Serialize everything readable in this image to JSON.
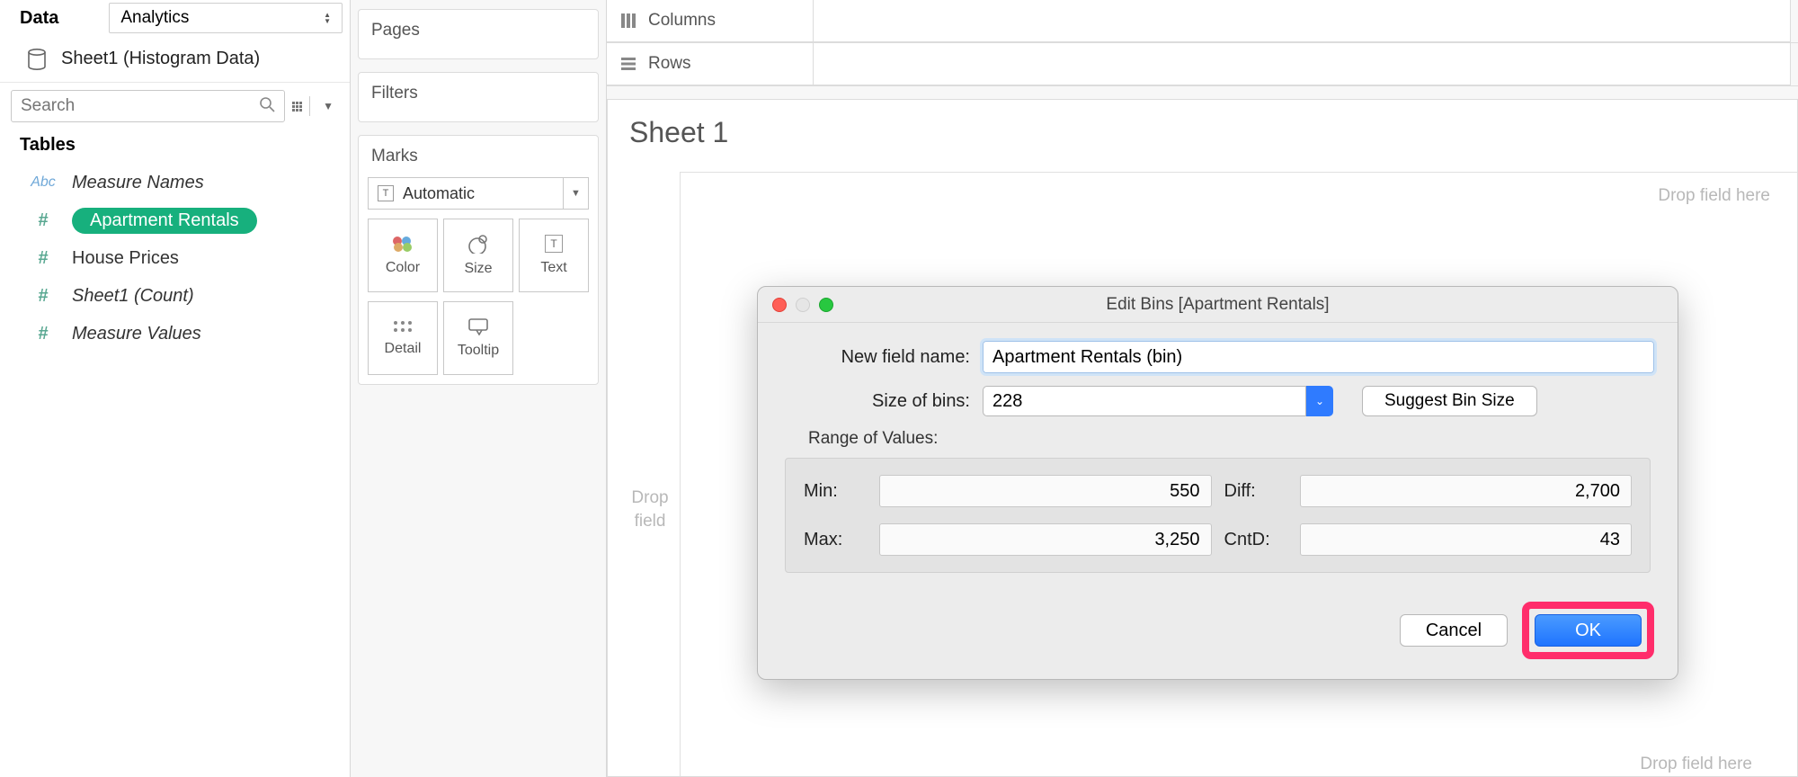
{
  "sidebar": {
    "data_tab": "Data",
    "analytics_tab": "Analytics",
    "datasource": "Sheet1 (Histogram Data)",
    "search_placeholder": "Search",
    "tables_label": "Tables",
    "fields": [
      {
        "type": "Abc",
        "name": "Measure Names"
      },
      {
        "type": "#",
        "name": "Apartment Rentals",
        "selected": true
      },
      {
        "type": "#",
        "name": "House Prices"
      },
      {
        "type": "#",
        "name": "Sheet1 (Count)"
      },
      {
        "type": "#",
        "name": "Measure Values"
      }
    ]
  },
  "shelves": {
    "pages": "Pages",
    "filters": "Filters",
    "marks": "Marks",
    "marks_type": "Automatic",
    "mark_btns": [
      "Color",
      "Size",
      "Text",
      "Detail",
      "Tooltip"
    ]
  },
  "colrow": {
    "columns": "Columns",
    "rows": "Rows"
  },
  "sheet": {
    "title": "Sheet 1",
    "drop_right": "Drop field here",
    "drop_left_1": "Drop",
    "drop_left_2": "field",
    "drop_bottom": "Drop field here"
  },
  "dialog": {
    "title": "Edit Bins [Apartment Rentals]",
    "new_field_label": "New field name:",
    "new_field_value": "Apartment Rentals (bin)",
    "size_label": "Size of bins:",
    "size_value": "228",
    "suggest": "Suggest Bin Size",
    "range_label": "Range of Values:",
    "min_l": "Min:",
    "min_v": "550",
    "max_l": "Max:",
    "max_v": "3,250",
    "diff_l": "Diff:",
    "diff_v": "2,700",
    "cntd_l": "CntD:",
    "cntd_v": "43",
    "cancel": "Cancel",
    "ok": "OK"
  }
}
